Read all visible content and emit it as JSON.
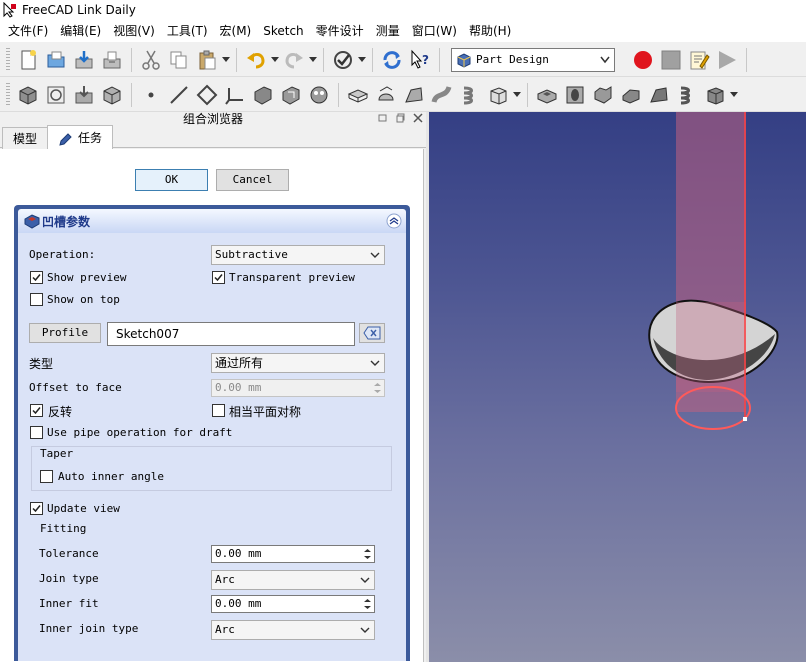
{
  "window": {
    "title": "FreeCAD Link Daily"
  },
  "menu": [
    "文件(F)",
    "编辑(E)",
    "视图(V)",
    "工具(T)",
    "宏(M)",
    "Sketch",
    "零件设计",
    "测量",
    "窗口(W)",
    "帮助(H)"
  ],
  "toolbar": {
    "workbench": "Part Design",
    "row1_icons": [
      "new-document-icon",
      "open-document-icon",
      "save-icon",
      "save-as-icon",
      "cut-icon",
      "copy-icon",
      "paste-icon",
      "undo-icon",
      "redo-icon",
      "refresh-icon",
      "whats-this-icon",
      "record-macro-icon",
      "stop-macro-icon",
      "edit-macro-icon",
      "run-macro-icon"
    ],
    "row2_icons": [
      "create-body-icon",
      "create-sketch-icon",
      "validate-sketch-icon",
      "clone-icon",
      "point-icon",
      "line-icon",
      "plane-icon",
      "lcs-icon",
      "shape-binder-icon",
      "subshape-binder-icon",
      "clone-alt-icon",
      "pad-icon",
      "revolution-icon",
      "additive-loft-icon",
      "additive-pipe-icon",
      "additive-helix-icon",
      "additive-box-icon",
      "pocket-icon",
      "hole-icon",
      "groove-icon",
      "subtractive-loft-icon",
      "subtractive-pipe-icon",
      "subtractive-helix-icon",
      "subtractive-box-icon"
    ]
  },
  "combo": {
    "title": "组合浏览器",
    "tabs": {
      "model": "模型",
      "tasks": "任务"
    }
  },
  "dialog": {
    "ok": "OK",
    "cancel": "Cancel",
    "box_title": "凹槽参数",
    "operation_label": "Operation:",
    "operation_value": "Subtractive",
    "show_preview": "Show preview",
    "transparent_preview": "Transparent preview",
    "show_on_top": "Show on top",
    "profile_button": "Profile",
    "profile_value": "Sketch007",
    "type_label": "类型",
    "type_value": "通过所有",
    "offset_label": "Offset to face",
    "offset_value": "0.00 mm",
    "reversed": "反转",
    "symmetric": "相当平面对称",
    "use_pipe": "Use pipe operation for draft",
    "taper_group": "Taper",
    "auto_inner_angle": "Auto inner angle",
    "update_view": "Update view",
    "fitting_group": "Fitting",
    "tolerance_label": "Tolerance",
    "tolerance_value": "0.00 mm",
    "join_type_label": "Join type",
    "join_type_value": "Arc",
    "inner_fit_label": "Inner fit",
    "inner_fit_value": "0.00 mm",
    "inner_join_label": "Inner join type",
    "inner_join_value": "Arc"
  },
  "checks": {
    "show_preview": true,
    "transparent_preview": true,
    "show_on_top": false,
    "reversed": true,
    "symmetric": false,
    "use_pipe": false,
    "auto_inner_angle": false,
    "update_view": true
  }
}
